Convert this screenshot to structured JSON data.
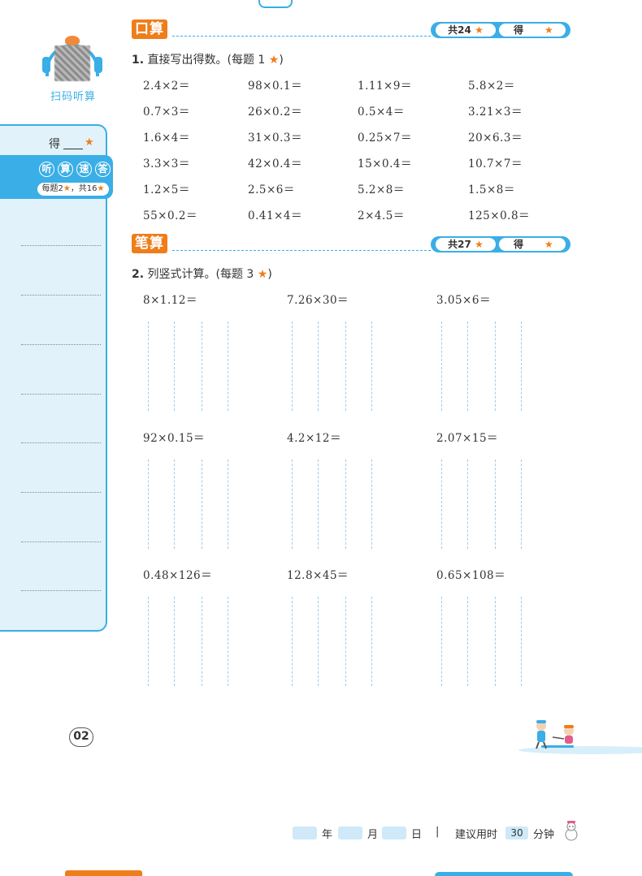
{
  "qr_label": "扫码听算",
  "sidebar": {
    "score_label": "得",
    "title_chars": [
      "听",
      "算",
      "速",
      "答"
    ],
    "rule_prefix": "每题2",
    "rule_suffix": "，共16"
  },
  "section1": {
    "tag": "口算",
    "total": "共24",
    "get": "得",
    "question_num": "1.",
    "question": "直接写出得数。(每题 1",
    "question_end": ")",
    "problems": [
      [
        "2.4×2＝",
        "98×0.1＝",
        "1.11×9＝",
        "5.8×2＝"
      ],
      [
        "0.7×3＝",
        "26×0.2＝",
        "0.5×4＝",
        "3.21×3＝"
      ],
      [
        "1.6×4＝",
        "31×0.3＝",
        "0.25×7＝",
        "20×6.3＝"
      ],
      [
        "3.3×3＝",
        "42×0.4＝",
        "15×0.4＝",
        "10.7×7＝"
      ],
      [
        "1.2×5＝",
        "2.5×6＝",
        "5.2×8＝",
        "1.5×8＝"
      ],
      [
        "55×0.2＝",
        "0.41×4＝",
        "2×4.5＝",
        "125×0.8＝"
      ]
    ]
  },
  "section2": {
    "tag": "笔算",
    "total": "共27",
    "get": "得",
    "question_num": "2.",
    "question": "列竖式计算。(每题 3",
    "question_end": ")",
    "problems": [
      [
        "8×1.12＝",
        "7.26×30＝",
        "3.05×6＝"
      ],
      [
        "92×0.15＝",
        "4.2×12＝",
        "2.07×15＝"
      ],
      [
        "0.48×126＝",
        "12.8×45＝",
        "0.65×108＝"
      ]
    ]
  },
  "page_number": "02",
  "footer": {
    "year": "年",
    "month": "月",
    "day": "日",
    "separator": "|",
    "suggest": "建议用时",
    "minutes": "30",
    "unit": "分钟"
  },
  "colors": {
    "accent_blue": "#3aaee6",
    "accent_orange": "#ef7d1a",
    "sidebar_bg": "#e1f2fb"
  }
}
